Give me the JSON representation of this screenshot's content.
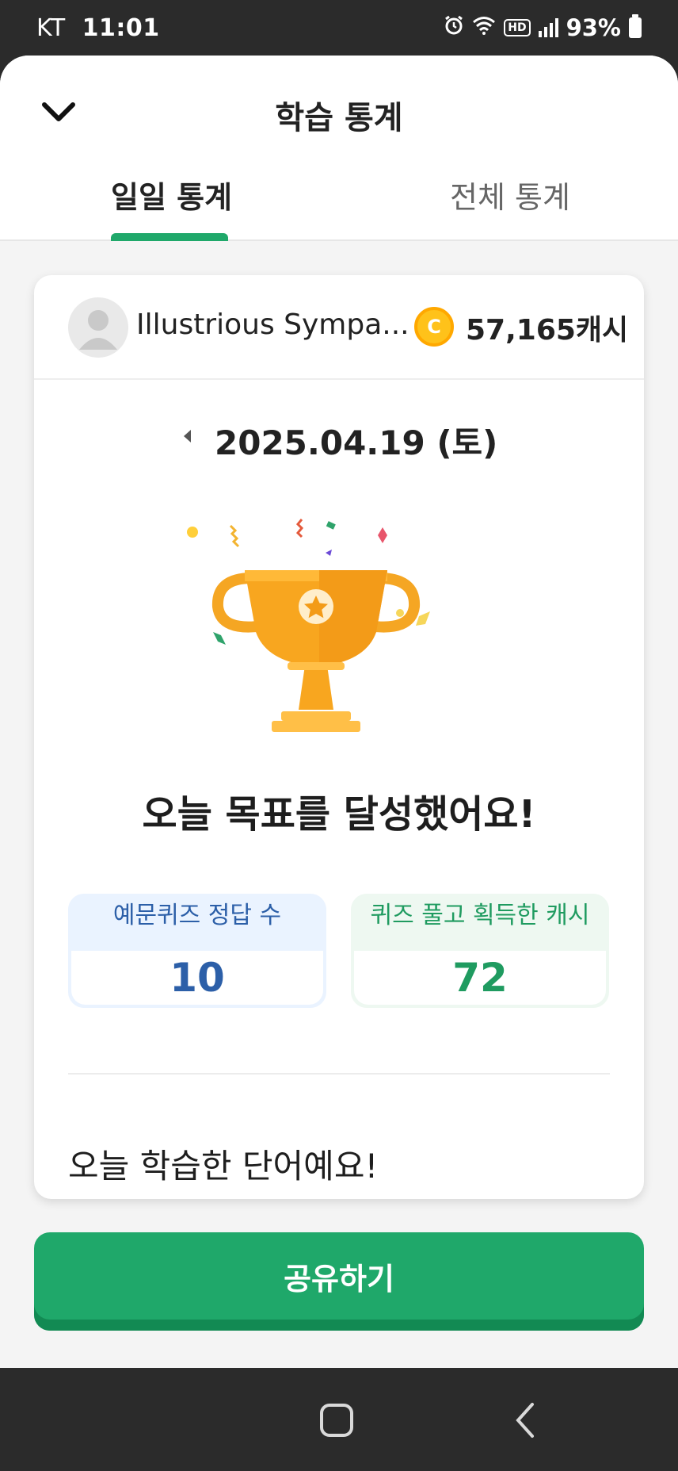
{
  "status": {
    "carrier": "KT",
    "time": "11:01",
    "hd": "HD",
    "battery": "93%",
    "icons": [
      "alarm-icon",
      "wifi-icon",
      "hd-voice-icon",
      "signal-icon",
      "battery-icon"
    ]
  },
  "header": {
    "title": "학습 통계",
    "tabs": [
      {
        "label": "일일 통계",
        "active": true
      },
      {
        "label": "전체 통계",
        "active": false
      }
    ]
  },
  "profile": {
    "name": "Illustrious Sympa...",
    "coin_symbol": "C",
    "cash": "57,165캐시"
  },
  "date": "2025.04.19 (토)",
  "goal_message": "오늘 목표를 달성했어요!",
  "stats": [
    {
      "title": "예문퀴즈 정답 수",
      "value": "10"
    },
    {
      "title": "퀴즈 풀고 획득한 캐시",
      "value": "72"
    }
  ],
  "words_title": "오늘 학습한 단어예요!",
  "share_label": "공유하기",
  "colors": {
    "accent": "#1fa86a",
    "accent_dark": "#128a53",
    "blue": "#2c5fa8",
    "gold": "#ffc21a"
  }
}
